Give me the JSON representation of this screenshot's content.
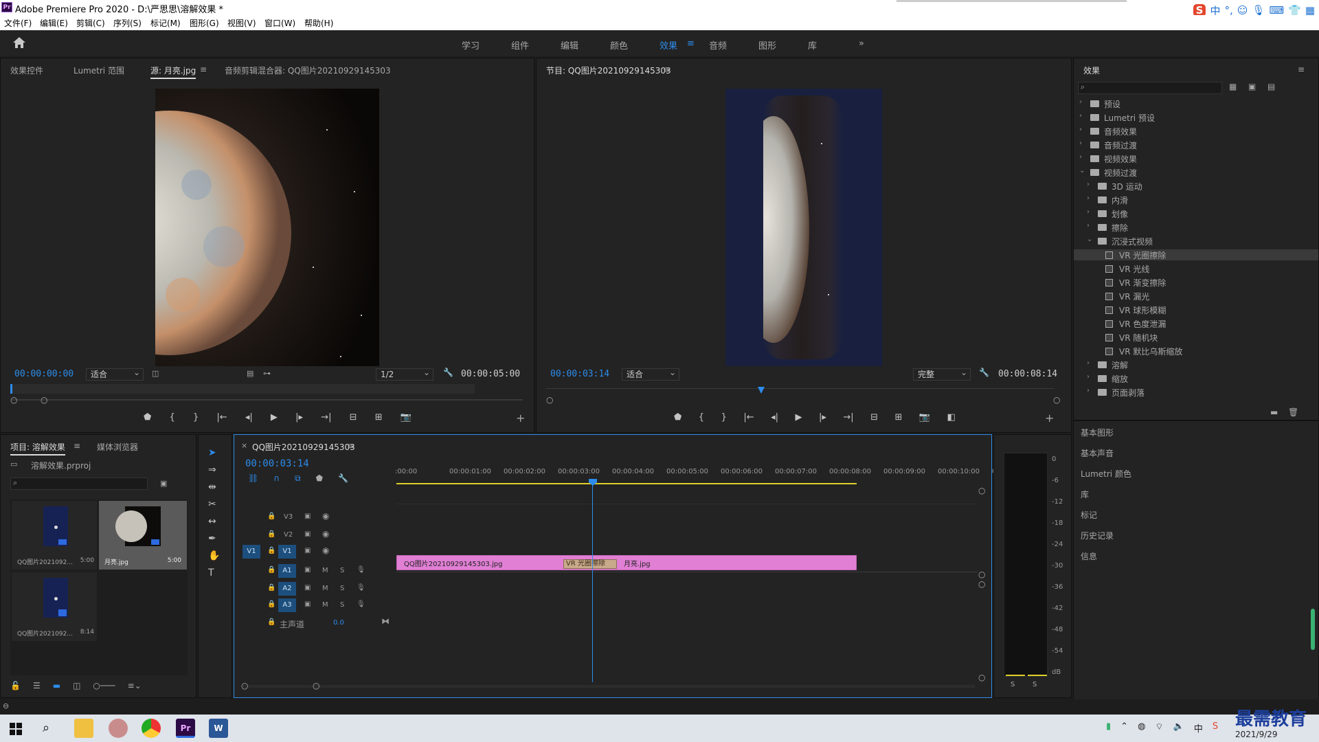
{
  "window": {
    "title": "Adobe Premiere Pro 2020 - D:\\严思思\\溶解效果 *"
  },
  "menu": [
    "文件(F)",
    "编辑(E)",
    "剪辑(C)",
    "序列(S)",
    "标记(M)",
    "图形(G)",
    "视图(V)",
    "窗口(W)",
    "帮助(H)"
  ],
  "ime": {
    "label": "中"
  },
  "workspaces": [
    "学习",
    "组件",
    "编辑",
    "颜色",
    "效果",
    "音频",
    "图形",
    "库"
  ],
  "active_workspace": "效果",
  "source_panel": {
    "tabs": [
      "效果控件",
      "Lumetri 范围",
      "源: 月亮.jpg",
      "音频剪辑混合器: QQ图片20210929145303"
    ],
    "current_time": "00:00:00:00",
    "fit": "适合",
    "resolution": "1/2",
    "duration": "00:00:05:00"
  },
  "program_panel": {
    "title": "节目: QQ图片20210929145303",
    "current_time": "00:00:03:14",
    "fit": "适合",
    "quality": "完整",
    "duration": "00:00:08:14"
  },
  "effects_panel": {
    "title": "效果",
    "tree": [
      {
        "label": "预设",
        "level": 0,
        "type": "folder"
      },
      {
        "label": "Lumetri 预设",
        "level": 0,
        "type": "folder"
      },
      {
        "label": "音频效果",
        "level": 0,
        "type": "folder"
      },
      {
        "label": "音频过渡",
        "level": 0,
        "type": "folder"
      },
      {
        "label": "视频效果",
        "level": 0,
        "type": "folder"
      },
      {
        "label": "视频过渡",
        "level": 0,
        "type": "folder",
        "open": true
      },
      {
        "label": "3D 运动",
        "level": 1,
        "type": "folder"
      },
      {
        "label": "内滑",
        "level": 1,
        "type": "folder"
      },
      {
        "label": "划像",
        "level": 1,
        "type": "folder"
      },
      {
        "label": "擦除",
        "level": 1,
        "type": "folder"
      },
      {
        "label": "沉浸式视频",
        "level": 1,
        "type": "folder",
        "open": true
      },
      {
        "label": "VR 光圈擦除",
        "level": 2,
        "type": "fx",
        "selected": true
      },
      {
        "label": "VR 光线",
        "level": 2,
        "type": "fx"
      },
      {
        "label": "VR 渐变擦除",
        "level": 2,
        "type": "fx"
      },
      {
        "label": "VR 漏光",
        "level": 2,
        "type": "fx"
      },
      {
        "label": "VR 球形模糊",
        "level": 2,
        "type": "fx"
      },
      {
        "label": "VR 色度泄漏",
        "level": 2,
        "type": "fx"
      },
      {
        "label": "VR 随机块",
        "level": 2,
        "type": "fx"
      },
      {
        "label": "VR 默比乌斯缩放",
        "level": 2,
        "type": "fx"
      },
      {
        "label": "溶解",
        "level": 1,
        "type": "folder"
      },
      {
        "label": "缩放",
        "level": 1,
        "type": "folder"
      },
      {
        "label": "页面剥落",
        "level": 1,
        "type": "folder"
      }
    ],
    "side_panels": [
      "基本图形",
      "基本声音",
      "Lumetri 颜色",
      "库",
      "标记",
      "历史记录",
      "信息"
    ]
  },
  "project_panel": {
    "tabs": [
      "项目: 溶解效果",
      "媒体浏览器"
    ],
    "project_file": "溶解效果.prproj",
    "items": [
      {
        "name": "QQ图片2021092...",
        "duration": "5:00"
      },
      {
        "name": "月亮.jpg",
        "duration": "5:00"
      },
      {
        "name": "QQ图片2021092...",
        "duration": "8:14"
      }
    ]
  },
  "timeline": {
    "sequence_name": "QQ图片20210929145303",
    "current_time": "00:00:03:14",
    "ruler": [
      ":00:00",
      "00:00:01:00",
      "00:00:02:00",
      "00:00:03:00",
      "00:00:04:00",
      "00:00:05:00",
      "00:00:06:00",
      "00:00:07:00",
      "00:00:08:00",
      "00:00:09:00",
      "00:00:10:00",
      "0"
    ],
    "video_tracks": [
      "V3",
      "V2",
      "V1"
    ],
    "audio_tracks": [
      "A1",
      "A2",
      "A3"
    ],
    "source_patch": "V1",
    "master": {
      "label": "主声道",
      "value": "0.0"
    },
    "clips": [
      {
        "name": "QQ图片20210929145303.jpg"
      },
      {
        "name": "月亮.jpg"
      }
    ],
    "transition": "VR 光圈擦除",
    "m_label": "M",
    "s_label": "S"
  },
  "audio_meter": {
    "ticks": [
      "0",
      "-6",
      "-12",
      "-18",
      "-24",
      "-30",
      "-36",
      "-42",
      "-48",
      "-54",
      "dB"
    ],
    "solo": [
      "S",
      "S"
    ]
  },
  "taskbar": {
    "date": "2021/9/29"
  },
  "watermark": "最需教育"
}
